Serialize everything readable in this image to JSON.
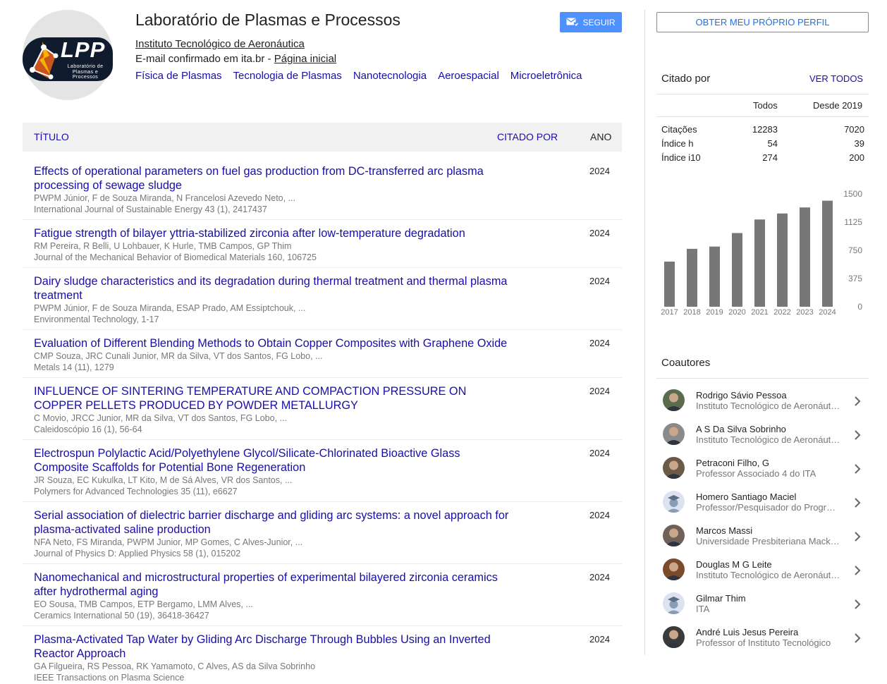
{
  "profile": {
    "logo_text": "LPP",
    "logo_subtext": "Laboratório de Plasmas e Processos",
    "name": "Laboratório de Plasmas e Processos",
    "affiliation": "Instituto Tecnológico de Aeronáutica",
    "email_text": "E-mail confirmado em ita.br - ",
    "homepage_label": "Página inicial",
    "interests": [
      "Física de Plasmas",
      "Tecnologia de Plasmas",
      "Nanotecnologia",
      "Aeroespacial",
      "Microeletrônica"
    ],
    "follow_label": "SEGUIR"
  },
  "table": {
    "col_title": "TÍTULO",
    "col_cited": "CITADO POR",
    "col_year": "ANO",
    "rows": [
      {
        "title": "Effects of operational parameters on fuel gas production from DC-transferred arc plasma processing of sewage sludge",
        "authors": "PWPM Júnior, F de Souza Miranda, N Francelosi Azevedo Neto, ...",
        "venue": "International Journal of Sustainable Energy 43 (1), 2417437",
        "year": "2024"
      },
      {
        "title": "Fatigue strength of bilayer yttria-stabilized zirconia after low-temperature degradation",
        "authors": "RM Pereira, R Belli, U Lohbauer, K Hurle, TMB Campos, GP Thim",
        "venue": "Journal of the Mechanical Behavior of Biomedical Materials 160, 106725",
        "year": "2024"
      },
      {
        "title": "Dairy sludge characteristics and its degradation during thermal treatment and thermal plasma treatment",
        "authors": "PWPM Júnior, F de Souza Miranda, ESAP Prado, AM Essiptchouk, ...",
        "venue": "Environmental Technology, 1-17",
        "year": "2024"
      },
      {
        "title": "Evaluation of Different Blending Methods to Obtain Copper Composites with Graphene Oxide",
        "authors": "CMP Souza, JRC Cunali Junior, MR da Silva, VT dos Santos, FG Lobo, ...",
        "venue": "Metals 14 (11), 1279",
        "year": "2024"
      },
      {
        "title": "INFLUENCE OF SINTERING TEMPERATURE AND COMPACTION PRESSURE ON COPPER PELLETS PRODUCED BY POWDER METALLURGY",
        "authors": "C Movio, JRCC Junior, MR da Silva, VT dos Santos, FG Lobo, ...",
        "venue": "Caleidoscópio 16 (1), 56-64",
        "year": "2024"
      },
      {
        "title": "Electrospun Polylactic Acid/Polyethylene Glycol/Silicate-Chlorinated Bioactive Glass Composite Scaffolds for Potential Bone Regeneration",
        "authors": "JR Souza, EC Kukulka, LT Kito, M de Sá Alves, VR dos Santos, ...",
        "venue": "Polymers for Advanced Technologies 35 (11), e6627",
        "year": "2024"
      },
      {
        "title": "Serial association of dielectric barrier discharge and gliding arc systems: a novel approach for plasma-activated saline production",
        "authors": "NFA Neto, FS Miranda, PWPM Junior, MP Gomes, C Alves-Junior, ...",
        "venue": "Journal of Physics D: Applied Physics 58 (1), 015202",
        "year": "2024"
      },
      {
        "title": "Nanomechanical and microstructural properties of experimental bilayered zirconia ceramics after hydrothermal aging",
        "authors": "EO Sousa, TMB Campos, ETP Bergamo, LMM Alves, ...",
        "venue": "Ceramics International 50 (19), 36418-36427",
        "year": "2024"
      },
      {
        "title": "Plasma-Activated Tap Water by Gliding Arc Discharge Through Bubbles Using an Inverted Reactor Approach",
        "authors": "GA Filgueira, RS Pessoa, RK Yamamoto, C Alves, AS da Silva Sobrinho",
        "venue": "IEEE Transactions on Plasma Science",
        "year": "2024"
      }
    ]
  },
  "sidebar": {
    "own_profile_label": "OBTER MEU PRÓPRIO PERFIL",
    "cited_by_title": "Citado por",
    "see_all_label": "VER TODOS",
    "col_all": "Todos",
    "col_since": "Desde 2019",
    "metrics": [
      {
        "label": "Citações",
        "all": "12283",
        "since": "7020"
      },
      {
        "label": "Índice h",
        "all": "54",
        "since": "39"
      },
      {
        "label": "Índice i10",
        "all": "274",
        "since": "200"
      }
    ],
    "coauthors_title": "Coautores",
    "coauthors": [
      {
        "name": "Rodrigo Sávio Pessoa",
        "affil": "Instituto Tecnológico de Aeronáutica",
        "avatar": "photo"
      },
      {
        "name": "A S Da Silva Sobrinho",
        "affil": "Instituto Tecnológico de Aeronáutica",
        "avatar": "photo"
      },
      {
        "name": "Petraconi Filho, G",
        "affil": "Professor Associado 4 do ITA",
        "avatar": "photo"
      },
      {
        "name": "Homero Santiago Maciel",
        "affil": "Professor/Pesquisador do Programa",
        "avatar": "graduate-placeholder"
      },
      {
        "name": "Marcos Massi",
        "affil": "Universidade Presbiteriana Mackenzie",
        "avatar": "photo"
      },
      {
        "name": "Douglas M G Leite",
        "affil": "Instituto Tecnológico de Aeronáutica",
        "avatar": "photo"
      },
      {
        "name": "Gilmar Thim",
        "affil": "ITA",
        "avatar": "graduate-placeholder"
      },
      {
        "name": "André Luis Jesus Pereira",
        "affil": "Professor of Instituto Tecnológico",
        "avatar": "photo"
      }
    ]
  },
  "chart_data": {
    "type": "bar",
    "categories": [
      "2017",
      "2018",
      "2019",
      "2020",
      "2021",
      "2022",
      "2023",
      "2024"
    ],
    "values": [
      600,
      770,
      800,
      980,
      1160,
      1240,
      1320,
      1410
    ],
    "ylim": [
      0,
      1500
    ],
    "yticks": [
      "1500",
      "1125",
      "750",
      "375",
      "0"
    ],
    "bar_color": "#777777",
    "title": "",
    "xlabel": "",
    "ylabel": ""
  },
  "colors": {
    "link": "#1a0dab",
    "follow_button": "#4d90fe",
    "muted_text": "#777777"
  }
}
